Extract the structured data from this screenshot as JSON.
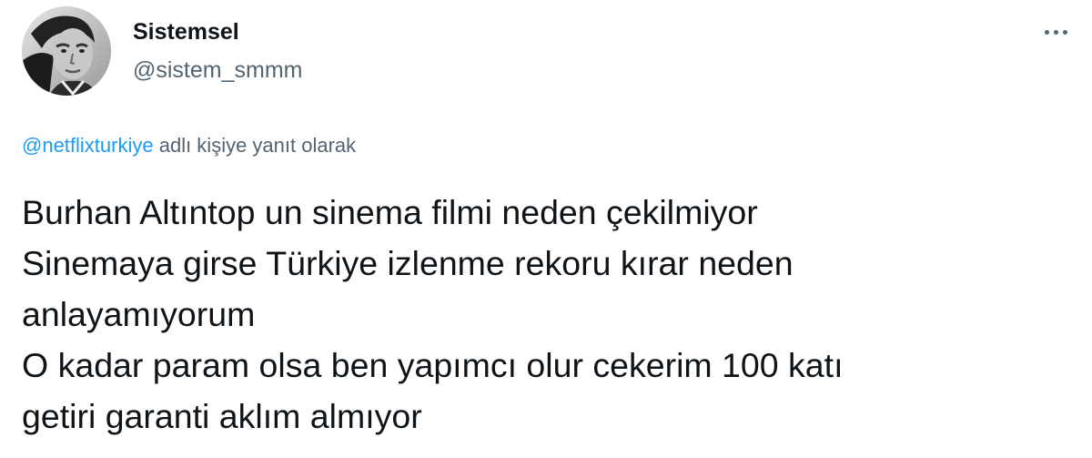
{
  "author": {
    "display_name": "Sistemsel",
    "handle": "@sistem_smmm",
    "avatar_icon": "user-avatar"
  },
  "more_icon": "more-horizontal-icon",
  "reply_context": {
    "mention": "@netflixturkiye",
    "suffix": " adlı kişiye yanıt olarak"
  },
  "tweet": {
    "lines": [
      "Burhan Altıntop un sinema filmi neden çekilmiyor",
      "Sinemaya girse Türkiye izlenme rekoru kırar neden",
      "anlayamıyorum",
      "O kadar param olsa ben yapımcı olur cekerim 100 katı",
      "getiri garanti aklım almıyor"
    ]
  },
  "colors": {
    "text_primary": "#0f1419",
    "text_secondary": "#536471",
    "link": "#1d9bf0"
  }
}
